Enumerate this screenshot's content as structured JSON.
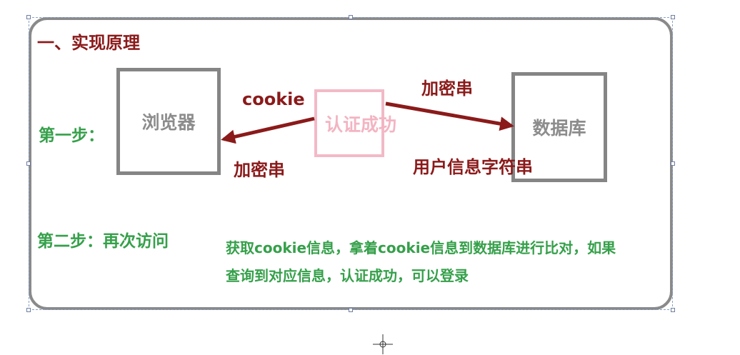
{
  "title": "一、实现原理",
  "step1": {
    "label": "第一步："
  },
  "step2": {
    "label": "第二步：再次访问"
  },
  "nodes": {
    "browser": "浏览器",
    "auth": "认证成功",
    "database": "数据库"
  },
  "arrow_labels": {
    "cookie": "cookie",
    "encrypted_to_browser": "加密串",
    "encrypted_to_db": "加密串",
    "user_info_string": "用户信息字符串"
  },
  "description": {
    "line1": "获取cookie信息，拿着cookie信息到数据库进行比对，如果",
    "line2": "查询到对应信息，认证成功，可以登录"
  },
  "colors": {
    "title": "#8b1a1a",
    "step": "#35a04a",
    "arrow": "#8b1a1a",
    "box_border": "#858585",
    "auth_border": "#f2b9c6"
  }
}
